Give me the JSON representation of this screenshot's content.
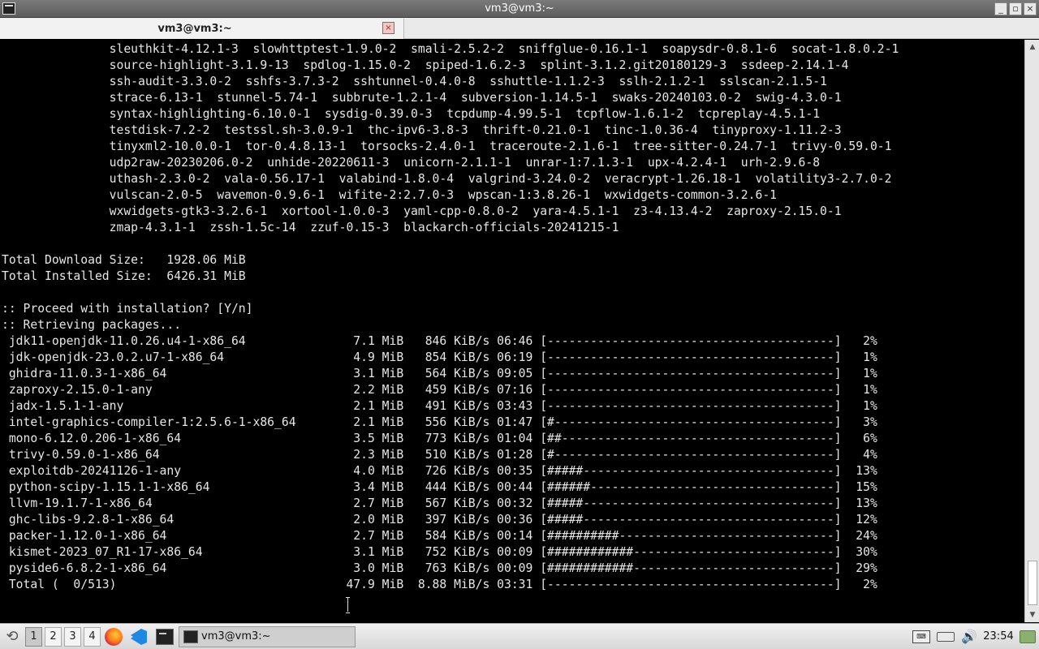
{
  "window": {
    "title": "vm3@vm3:~"
  },
  "tab": {
    "label": "vm3@vm3:~",
    "close_glyph": "×"
  },
  "titlebar_buttons": {
    "minimize": "_",
    "maximize": "▫",
    "close": "×"
  },
  "terminal": {
    "lines": [
      "               sleuthkit-4.12.1-3  slowhttptest-1.9.0-2  smali-2.5.2-2  sniffglue-0.16.1-1  soapysdr-0.8.1-6  socat-1.8.0.2-1",
      "               source-highlight-3.1.9-13  spdlog-1.15.0-2  spiped-1.6.2-3  splint-3.1.2.git20180129-3  ssdeep-2.14.1-4",
      "               ssh-audit-3.3.0-2  sshfs-3.7.3-2  sshtunnel-0.4.0-8  sshuttle-1.1.2-3  sslh-2.1.2-1  sslscan-2.1.5-1",
      "               strace-6.13-1  stunnel-5.74-1  subbrute-1.2.1-4  subversion-1.14.5-1  swaks-20240103.0-2  swig-4.3.0-1",
      "               syntax-highlighting-6.10.0-1  sysdig-0.39.0-3  tcpdump-4.99.5-1  tcpflow-1.6.1-2  tcpreplay-4.5.1-1",
      "               testdisk-7.2-2  testssl.sh-3.0.9-1  thc-ipv6-3.8-3  thrift-0.21.0-1  tinc-1.0.36-4  tinyproxy-1.11.2-3",
      "               tinyxml2-10.0.0-1  tor-0.4.8.13-1  torsocks-2.4.0-1  traceroute-2.1.6-1  tree-sitter-0.24.7-1  trivy-0.59.0-1",
      "               udp2raw-20230206.0-2  unhide-20220611-3  unicorn-2.1.1-1  unrar-1:7.1.3-1  upx-4.2.4-1  urh-2.9.6-8",
      "               uthash-2.3.0-2  vala-0.56.17-1  valabind-1.8.0-4  valgrind-3.24.0-2  veracrypt-1.26.18-1  volatility3-2.7.0-2",
      "               vulscan-2.0-5  wavemon-0.9.6-1  wifite-2:2.7.0-3  wpscan-1:3.8.26-1  wxwidgets-common-3.2.6-1",
      "               wxwidgets-gtk3-3.2.6-1  xortool-1.0.0-3  yaml-cpp-0.8.0-2  yara-4.5.1-1  z3-4.13.4-2  zaproxy-2.15.0-1",
      "               zmap-4.3.1-1  zssh-1.5c-14  zzuf-0.15-3  blackarch-officials-20241215-1",
      "",
      "Total Download Size:   1928.06 MiB",
      "Total Installed Size:  6426.31 MiB",
      "",
      ":: Proceed with installation? [Y/n]",
      ":: Retrieving packages...",
      " jdk11-openjdk-11.0.26.u4-1-x86_64               7.1 MiB   846 KiB/s 06:46 [----------------------------------------]   2%",
      " jdk-openjdk-23.0.2.u7-1-x86_64                  4.9 MiB   854 KiB/s 06:19 [----------------------------------------]   1%",
      " ghidra-11.0.3-1-x86_64                          3.1 MiB   564 KiB/s 09:05 [----------------------------------------]   1%",
      " zaproxy-2.15.0-1-any                            2.2 MiB   459 KiB/s 07:16 [----------------------------------------]   1%",
      " jadx-1.5.1-1-any                                2.1 MiB   491 KiB/s 03:43 [----------------------------------------]   1%",
      " intel-graphics-compiler-1:2.5.6-1-x86_64        2.1 MiB   556 KiB/s 01:47 [#---------------------------------------]   3%",
      " mono-6.12.0.206-1-x86_64                        3.5 MiB   773 KiB/s 01:04 [##--------------------------------------]   6%",
      " trivy-0.59.0-1-x86_64                           2.3 MiB   510 KiB/s 01:28 [#---------------------------------------]   4%",
      " exploitdb-20241126-1-any                        4.0 MiB   726 KiB/s 00:35 [#####-----------------------------------]  13%",
      " python-scipy-1.15.1-1-x86_64                    3.4 MiB   444 KiB/s 00:44 [######----------------------------------]  15%",
      " llvm-19.1.7-1-x86_64                            2.7 MiB   567 KiB/s 00:32 [#####-----------------------------------]  13%",
      " ghc-libs-9.2.8-1-x86_64                         2.0 MiB   397 KiB/s 00:36 [#####-----------------------------------]  12%",
      " packer-1.12.0-1-x86_64                          2.7 MiB   584 KiB/s 00:14 [##########------------------------------]  24%",
      " kismet-2023_07_R1-17-x86_64                     3.1 MiB   752 KiB/s 00:09 [############----------------------------]  30%",
      " pyside6-6.8.2-1-x86_64                          3.0 MiB   763 KiB/s 00:09 [############----------------------------]  29%",
      " Total (  0/513)                                47.9 MiB  8.88 MiB/s 03:31 [----------------------------------------]   2%"
    ]
  },
  "taskbar": {
    "workspaces": [
      "1",
      "2",
      "3",
      "4"
    ],
    "active_workspace": "1",
    "task_window_label": "vm3@vm3:~",
    "clock": "23:54",
    "menu_icon": "menu-icon",
    "launchers": [
      "firefox-icon",
      "vscode-icon",
      "terminal-icon"
    ],
    "tray": [
      "keyboard-icon",
      "drive-icon",
      "volume-icon",
      "folder-icon"
    ]
  }
}
